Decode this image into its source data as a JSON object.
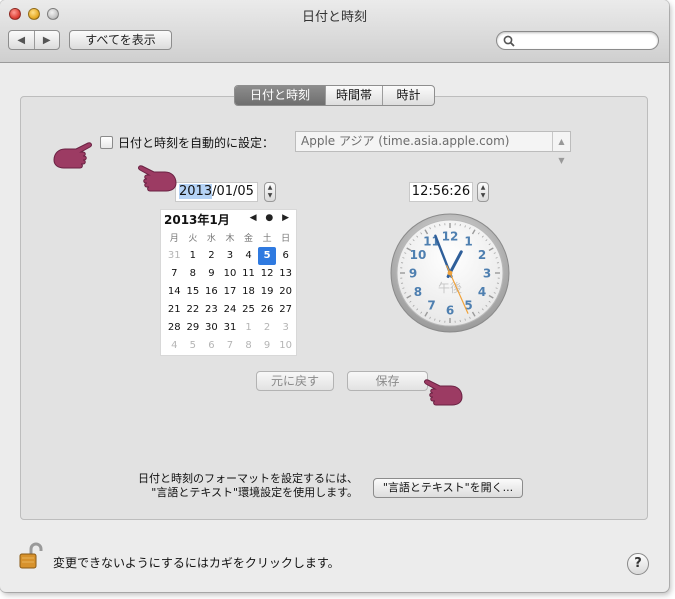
{
  "window": {
    "title": "日付と時刻"
  },
  "toolbar": {
    "back": "◀",
    "forward": "▶",
    "show_all": "すべてを表示",
    "search_placeholder": ""
  },
  "tabs": [
    {
      "label": "日付と時刻",
      "active": true
    },
    {
      "label": "時間帯",
      "active": false
    },
    {
      "label": "時計",
      "active": false
    }
  ],
  "auto_set": {
    "label": "日付と時刻を自動的に設定：",
    "checked": false,
    "server": "Apple アジア (time.asia.apple.com)"
  },
  "date": {
    "year_selected": "2013",
    "rest": "/01/05"
  },
  "time": {
    "value": "12:56:26"
  },
  "calendar": {
    "title": "2013年1月",
    "nav": "◀ ● ▶",
    "weekdays": [
      "月",
      "火",
      "水",
      "木",
      "金",
      "土",
      "日"
    ],
    "weeks": [
      [
        "31",
        "1",
        "2",
        "3",
        "4",
        "5",
        "6"
      ],
      [
        "7",
        "8",
        "9",
        "10",
        "11",
        "12",
        "13"
      ],
      [
        "14",
        "15",
        "16",
        "17",
        "18",
        "19",
        "20"
      ],
      [
        "21",
        "22",
        "23",
        "24",
        "25",
        "26",
        "27"
      ],
      [
        "28",
        "29",
        "30",
        "31",
        "1",
        "2",
        "3"
      ],
      [
        "4",
        "5",
        "6",
        "7",
        "8",
        "9",
        "10"
      ]
    ],
    "dim_first_row_count": 1,
    "dim_from_index": 32,
    "today": "5"
  },
  "clock": {
    "numbers": [
      "12",
      "1",
      "2",
      "3",
      "4",
      "5",
      "6",
      "7",
      "8",
      "9",
      "10",
      "11"
    ],
    "period": "午後",
    "hour": 12,
    "minute": 56,
    "second": 26
  },
  "buttons": {
    "revert": "元に戻す",
    "save": "保存"
  },
  "format": {
    "line1": "日付と時刻のフォーマットを設定するには、",
    "line2": "\"言語とテキスト\"環境設定を使用します。",
    "open_button": "\"言語とテキスト\"を開く..."
  },
  "footer": {
    "lock_text": "変更できないようにするにはカギをクリックします。",
    "help": "?"
  },
  "colors": {
    "hand_cursor": "#9c3b63",
    "accent": "#2f7ae0",
    "clock_numbers": "#4e7fb0",
    "second_hand": "#f0a23a"
  }
}
